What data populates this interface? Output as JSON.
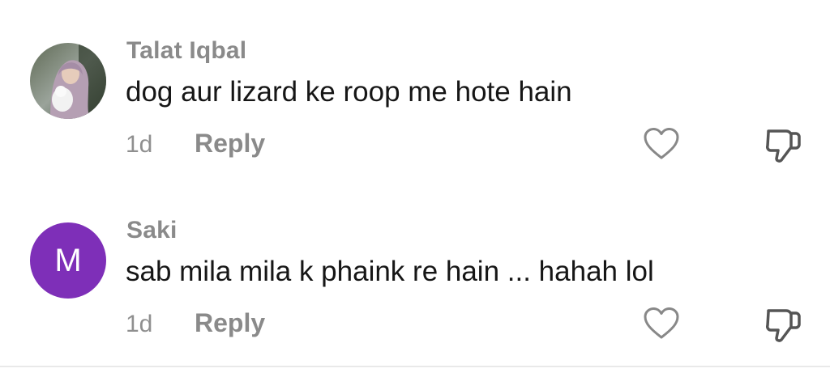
{
  "comments": [
    {
      "username": "Talat Iqbal",
      "text": "dog aur lizard ke roop me hote hain",
      "time": "1d",
      "reply_label": "Reply",
      "avatar_letter": ""
    },
    {
      "username": "Saki",
      "text": "sab mila mila k phaink re hain ... hahah lol",
      "time": "1d",
      "reply_label": "Reply",
      "avatar_letter": "M",
      "avatar_color": "#7e2fb8"
    }
  ],
  "icons": {
    "like": "heart-outline-icon",
    "dislike": "thumbs-down-outline-icon"
  }
}
